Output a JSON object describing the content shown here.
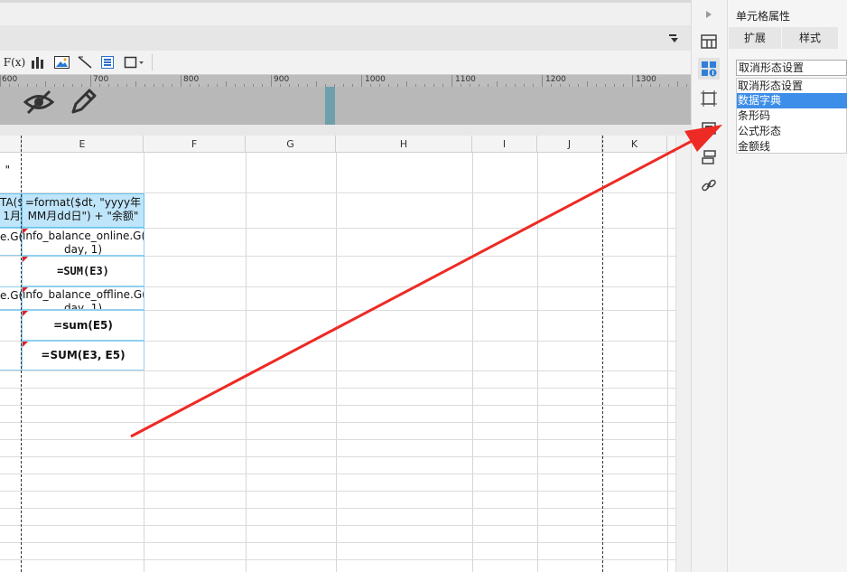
{
  "toolbar": {
    "buttons": [
      {
        "name": "formula-button",
        "label": "F(x)"
      },
      {
        "name": "chart-button",
        "label": ""
      },
      {
        "name": "image-button",
        "label": ""
      },
      {
        "name": "slash-button",
        "label": ""
      },
      {
        "name": "sub-report-button",
        "label": ""
      },
      {
        "name": "border-button",
        "label": ""
      }
    ]
  },
  "ruler": {
    "labels": [
      "600",
      "700",
      "800",
      "900",
      "1000",
      "1100",
      "1200",
      "1300"
    ]
  },
  "grid": {
    "columns": [
      "E",
      "F",
      "G",
      "H",
      "I",
      "J",
      "K"
    ],
    "cells": {
      "d1": "\"",
      "d2_line1": "TA($",
      "d2_line2": "1月",
      "e2_line1": "=format($dt, \"yyyy年",
      "e2_line2": "MM月dd日\") + \"余额\"",
      "d3": "e.G(",
      "e3_line1": "info_balance_online.G(",
      "e3_line2": "day, 1)",
      "e4": "=SUM(E3)",
      "d5": "e.G(",
      "e5_line1": "info_balance_offline.G(",
      "e5_line2": "day, 1)",
      "e6": "=sum(E5)",
      "e7": "=SUM(E3, E5)"
    }
  },
  "panel": {
    "title": "单元格属性",
    "tabs": [
      "扩展",
      "样式"
    ],
    "select_value": "取消形态设置",
    "options": [
      "取消形态设置",
      "数据字典",
      "条形码",
      "公式形态",
      "金额线"
    ],
    "selected_option": "数据字典"
  },
  "colors": {
    "selection_fill": "#bfe5fb",
    "selection_border": "#64c3ee",
    "dropdown_highlight": "#3d8ee8",
    "annotation_arrow": "#ee2a24",
    "float_marker": "#6f9fab"
  }
}
